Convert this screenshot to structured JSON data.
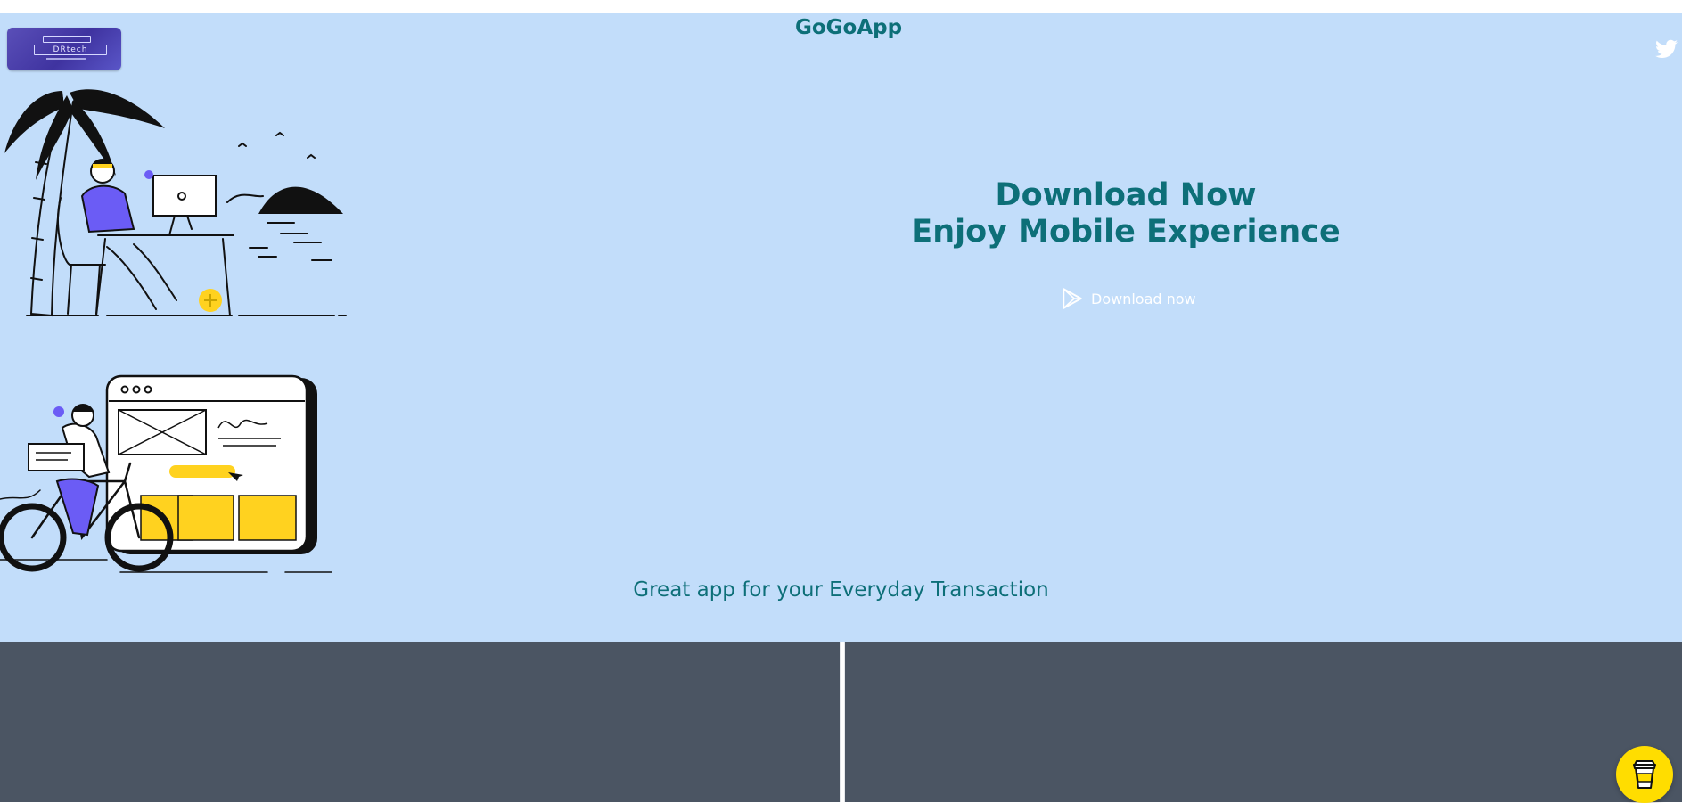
{
  "header": {
    "title": "GoGoApp",
    "logo_text": "DRtech",
    "social_icon": "twitter-icon"
  },
  "hero": {
    "headline_line1": "Download Now",
    "headline_line2": "Enjoy Mobile Experience",
    "download_label": "Download now",
    "download_icon": "play-store-icon",
    "tagline": "Great app for your Everyday Transaction"
  },
  "floating": {
    "coffee_icon": "coffee-cup-icon"
  },
  "colors": {
    "hero_background": "#c2ddfa",
    "accent_text": "#0d6f78",
    "panel_background": "#4b5563",
    "coffee_button": "#ffdd00",
    "illustration_accent": "#6b5cf5",
    "illustration_yellow": "#ffd21f"
  }
}
